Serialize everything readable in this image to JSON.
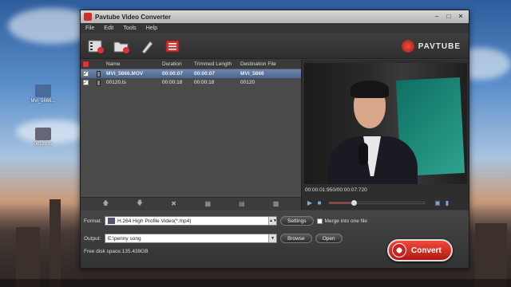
{
  "window": {
    "title": "Pavtube Video Converter",
    "brand": "PAVTUBE"
  },
  "desktop": {
    "icons": [
      {
        "label": "Mvi_5666..."
      },
      {
        "label": "00120.ts"
      }
    ]
  },
  "menu": [
    "File",
    "Edit",
    "Tools",
    "Help"
  ],
  "toolbar": {
    "buttons": [
      "add-video-icon",
      "add-folder-icon",
      "edit-icon",
      "task-list-icon"
    ]
  },
  "filelist": {
    "headers": {
      "name": "Name",
      "duration": "Duration",
      "trimmed": "Trimmed Length",
      "destination": "Destination File"
    },
    "rows": [
      {
        "checked": true,
        "name": "MVI_5666.MOV",
        "duration": "00:00:07",
        "trimmed": "00:00:07",
        "destination": "MVI_5666"
      },
      {
        "checked": true,
        "name": "00120.ts",
        "duration": "00:00:18",
        "trimmed": "00:00:18",
        "destination": "00120"
      }
    ]
  },
  "preview": {
    "timecode": "00:00:01:950/00:00:07:720",
    "progress": 0.25
  },
  "bottom": {
    "format_label": "Format:",
    "format_value": "H.264 High Profile Video(*.mp4)",
    "settings_label": "Settings",
    "merge_label": "Merge into one file",
    "output_label": "Output:",
    "output_value": "E:\\penny song",
    "browse_label": "Browse",
    "open_label": "Open",
    "free_disk": "Free disk space:135.439GB",
    "convert_label": "Convert"
  },
  "colors": {
    "accent": "#d9342a",
    "selection": "#5a74a0"
  }
}
